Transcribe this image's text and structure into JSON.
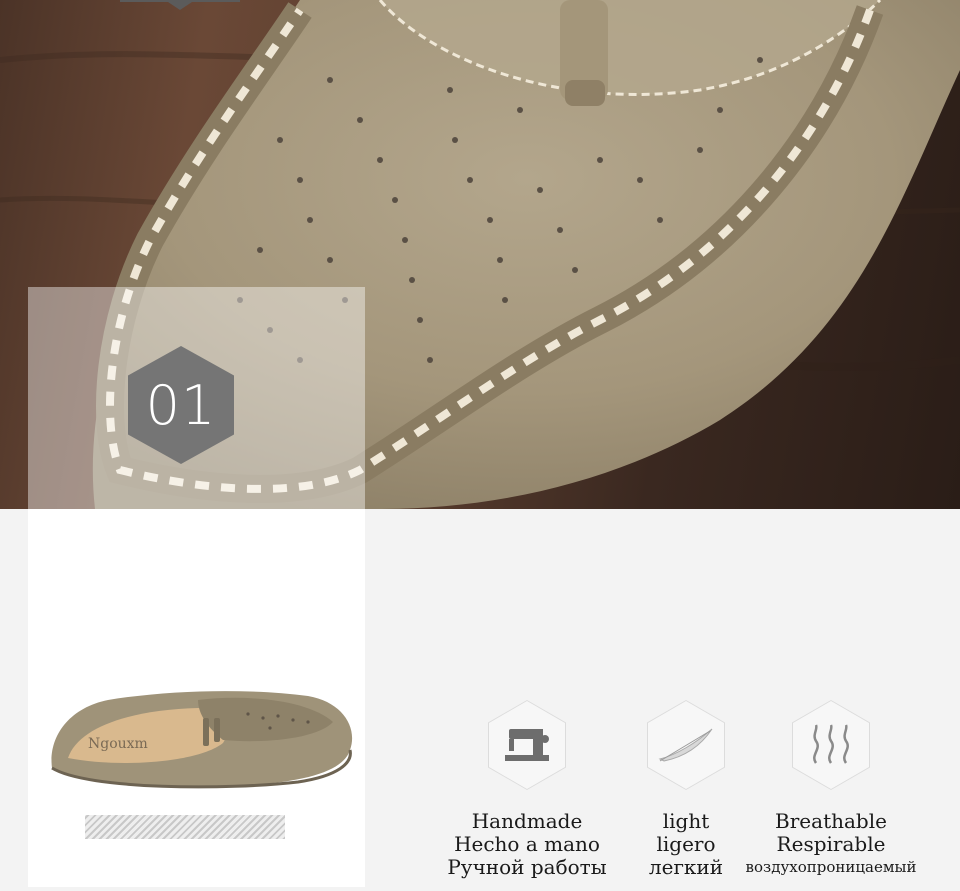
{
  "hero": {
    "badge_number": "01"
  },
  "product": {
    "insole_brand": "Ngouxm"
  },
  "features": [
    {
      "icon": "sewing-machine-icon",
      "lines": [
        "Handmade",
        "Hecho a mano",
        "Ручной работы"
      ]
    },
    {
      "icon": "feather-icon",
      "lines": [
        "light",
        "ligero",
        "легкий"
      ]
    },
    {
      "icon": "breathable-waves-icon",
      "lines": [
        "Breathable",
        "Respirable",
        "воздухопроницаемый"
      ]
    }
  ],
  "colors": {
    "suede": "#a89a80",
    "stitch": "#efe7d6",
    "badge": "#757575",
    "wood": "#5a3d2e"
  }
}
